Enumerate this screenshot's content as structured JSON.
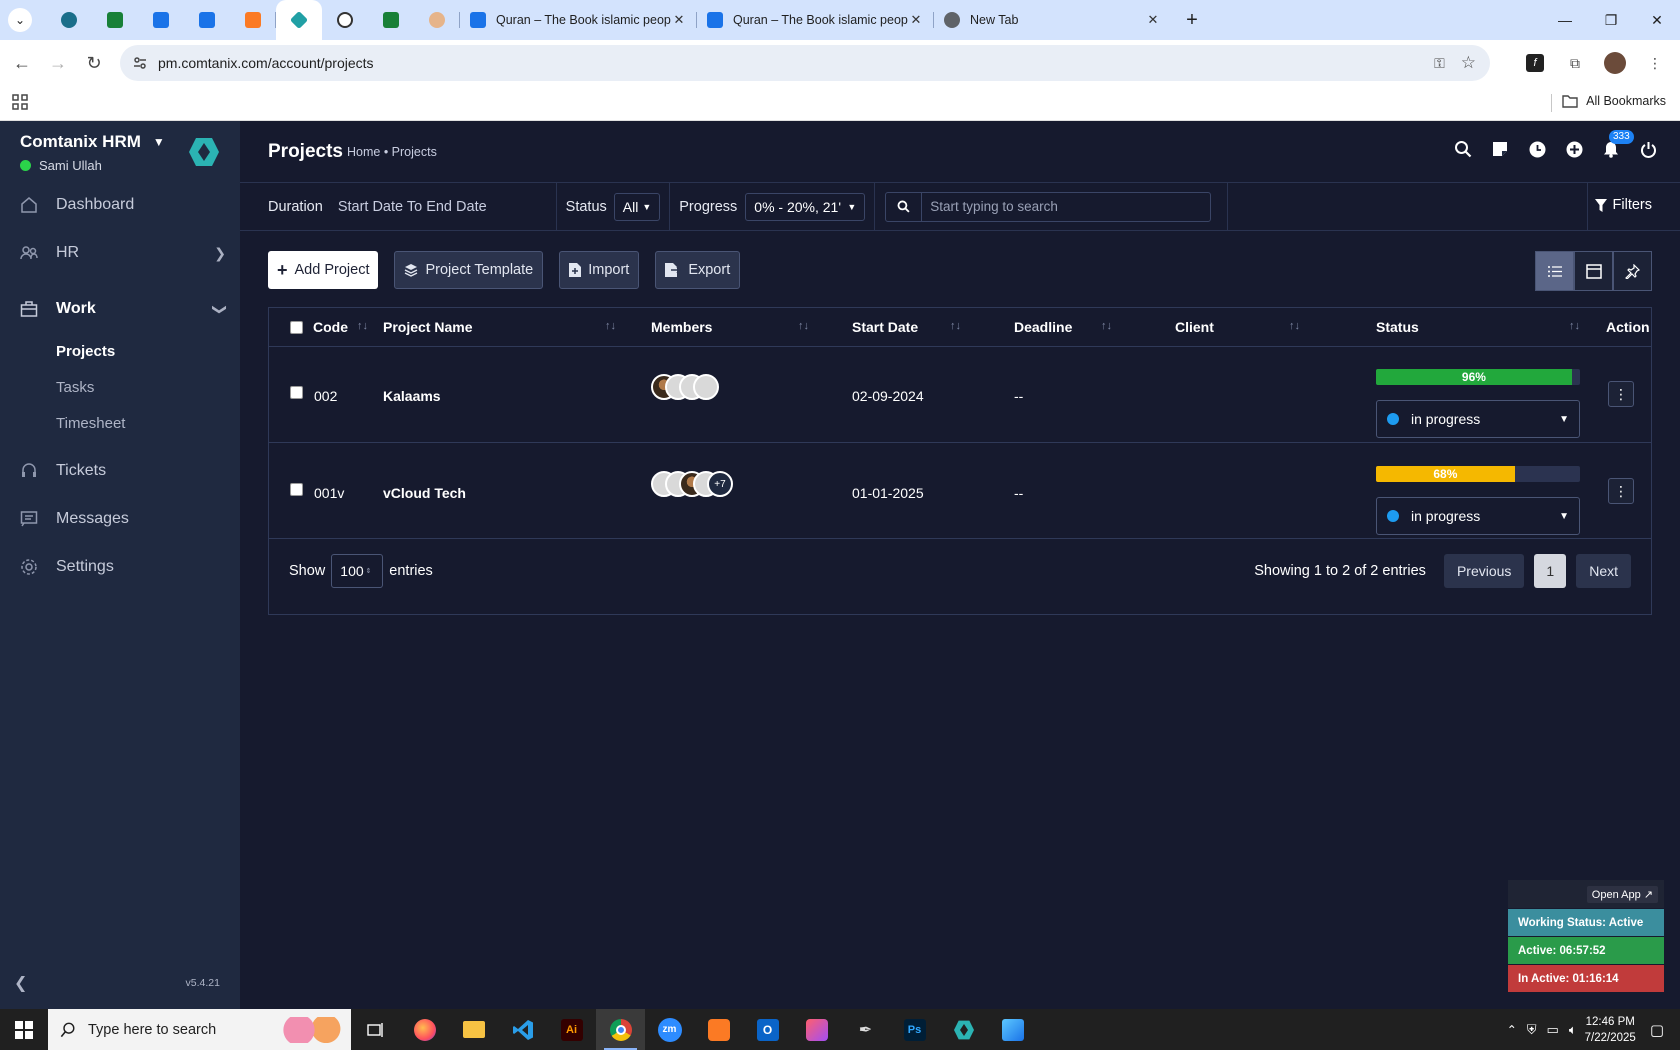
{
  "browser": {
    "tabs": [
      {
        "title": "Quran – The Book islamic peopl"
      },
      {
        "title": "Quran – The Book islamic peopl"
      },
      {
        "title": "New Tab"
      }
    ],
    "url": "pm.comtanix.com/account/projects",
    "all_bookmarks": "All Bookmarks"
  },
  "sidebar": {
    "company": "Comtanix HRM",
    "user": "Sami Ullah",
    "items": [
      {
        "label": "Dashboard"
      },
      {
        "label": "HR"
      },
      {
        "label": "Work"
      },
      {
        "label": "Tickets"
      },
      {
        "label": "Messages"
      },
      {
        "label": "Settings"
      }
    ],
    "sub_items": [
      {
        "label": "Projects"
      },
      {
        "label": "Tasks"
      },
      {
        "label": "Timesheet"
      }
    ],
    "version": "v5.4.21"
  },
  "header": {
    "title": "Projects",
    "breadcrumb": "Home • Projects",
    "notification_count": "333"
  },
  "filters": {
    "duration_label": "Duration",
    "duration_value": "Start Date To End Date",
    "status_label": "Status",
    "status_value": "All",
    "progress_label": "Progress",
    "progress_value": "0% - 20%, 21'",
    "search_placeholder": "Start typing to search",
    "filters_label": "Filters"
  },
  "actions": {
    "add": "Add Project",
    "template": "Project Template",
    "import": "Import",
    "export": "Export"
  },
  "table": {
    "columns": [
      "Code",
      "Project Name",
      "Members",
      "Start Date",
      "Deadline",
      "Client",
      "Status",
      "Action"
    ],
    "rows": [
      {
        "code": "002",
        "name": "Kalaams",
        "start_date": "02-09-2024",
        "deadline": "--",
        "client": "",
        "progress": 96,
        "progress_label": "96%",
        "progress_color": "#22a83c",
        "status": "in progress"
      },
      {
        "code": "001v",
        "name": "vCloud Tech",
        "start_date": "01-01-2025",
        "deadline": "--",
        "client": "",
        "progress": 68,
        "progress_label": "68%",
        "progress_color": "#f5b800",
        "status": "in progress",
        "extra_members": "+7"
      }
    ],
    "show_label": "Show",
    "entries_value": "100",
    "entries_label": "entries",
    "showing": "Showing 1 to 2 of 2 entries",
    "previous": "Previous",
    "page": "1",
    "next": "Next"
  },
  "tracker": {
    "open_app": "Open App ↗",
    "working_status": "Working Status: Active",
    "active": "Active: 06:57:52",
    "inactive": "In Active: 01:16:14"
  },
  "taskbar": {
    "search_placeholder": "Type here to search",
    "time": "12:46 PM",
    "date": "7/22/2025"
  }
}
